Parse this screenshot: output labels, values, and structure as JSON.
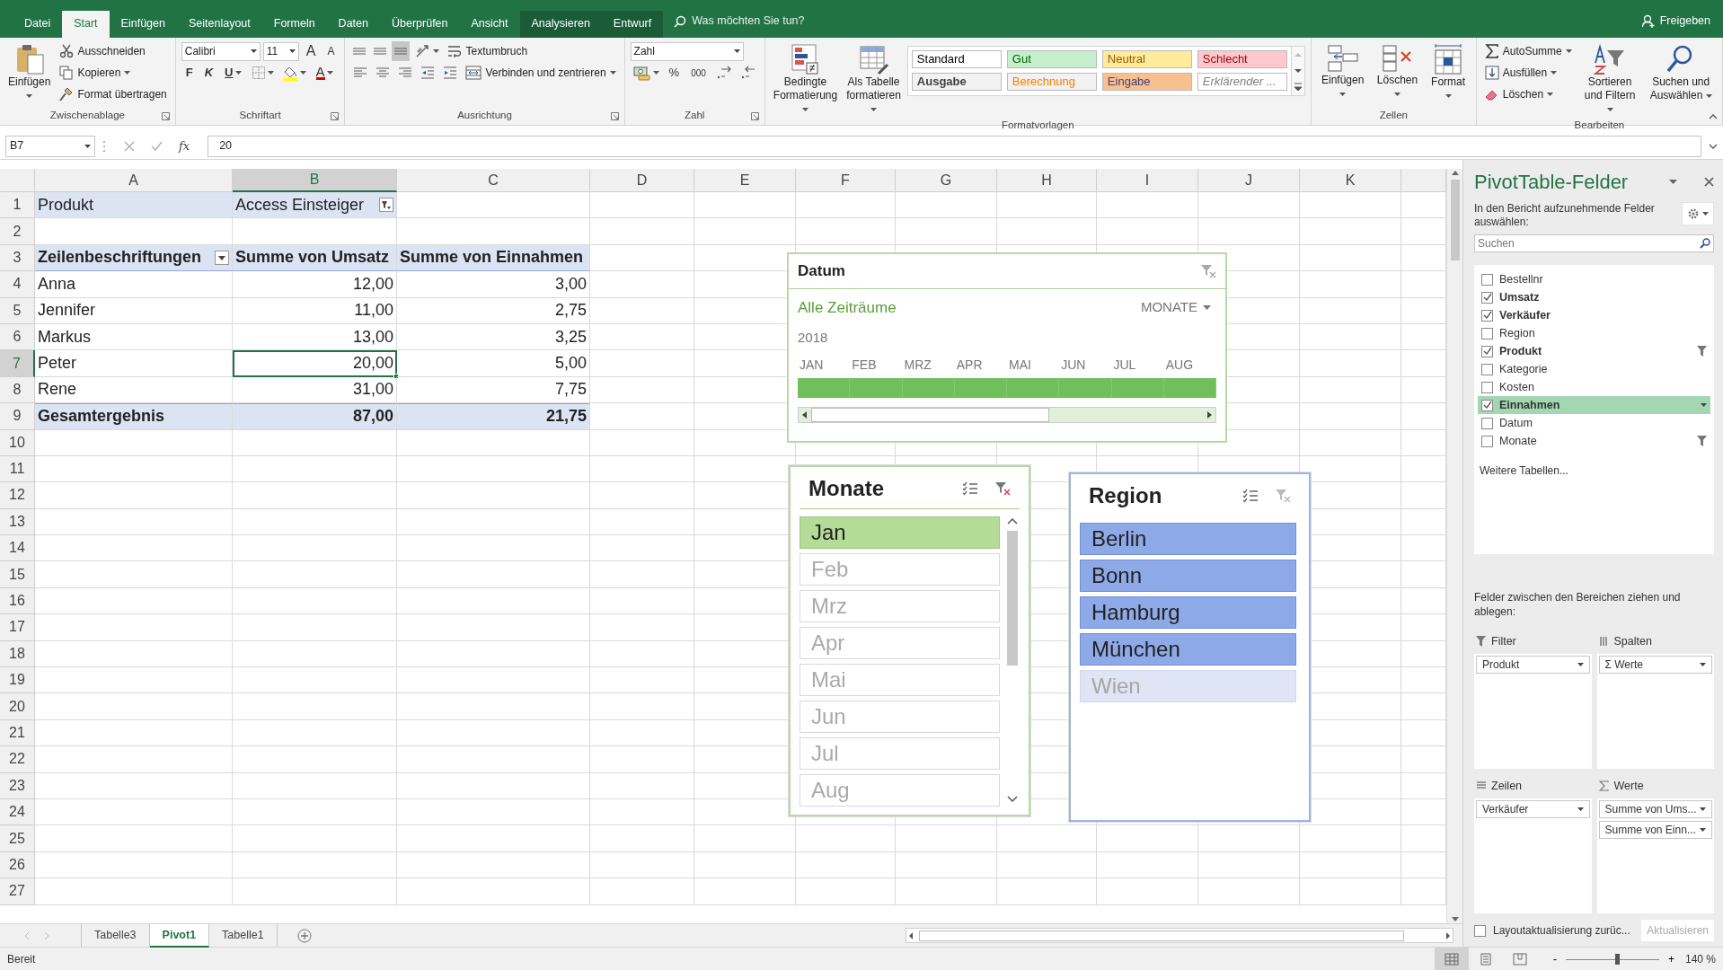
{
  "title_bar": {
    "tabs": [
      {
        "label": "Datei",
        "selected": false,
        "contextual": false
      },
      {
        "label": "Start",
        "selected": true,
        "contextual": false
      },
      {
        "label": "Einfügen",
        "selected": false,
        "contextual": false
      },
      {
        "label": "Seitenlayout",
        "selected": false,
        "contextual": false
      },
      {
        "label": "Formeln",
        "selected": false,
        "contextual": false
      },
      {
        "label": "Daten",
        "selected": false,
        "contextual": false
      },
      {
        "label": "Überprüfen",
        "selected": false,
        "contextual": false
      },
      {
        "label": "Ansicht",
        "selected": false,
        "contextual": false
      },
      {
        "label": "Analysieren",
        "selected": false,
        "contextual": true
      },
      {
        "label": "Entwurf",
        "selected": false,
        "contextual": true
      }
    ],
    "tell_me": "Was möchten Sie tun?",
    "share": "Freigeben"
  },
  "ribbon": {
    "groups": [
      {
        "label": "Zwischenablage",
        "launcher": true,
        "items": [
          {
            "kind": "large",
            "label": "Einfügen",
            "caret": true
          },
          {
            "kind": "stack",
            "rows": [
              {
                "items": [
                  {
                    "kind": "small",
                    "label": "Ausschneiden",
                    "caret": false
                  }
                ]
              },
              {
                "items": [
                  {
                    "kind": "small",
                    "label": "Kopieren",
                    "caret": true
                  }
                ]
              },
              {
                "items": [
                  {
                    "kind": "small",
                    "label": "Format übertragen",
                    "caret": false
                  }
                ]
              }
            ]
          }
        ]
      },
      {
        "label": "Schriftart",
        "launcher": true,
        "items": [
          {
            "kind": "stack",
            "rows": [
              {
                "items": [
                  {
                    "kind": "combo",
                    "value": "Calibri"
                  },
                  {
                    "kind": "combo",
                    "value": "11"
                  },
                  {
                    "kind": "glyph",
                    "label": "A",
                    "caret": false
                  },
                  {
                    "kind": "glyph",
                    "label": "A",
                    "caret": false
                  }
                ]
              },
              {
                "items": [
                  {
                    "kind": "glyph",
                    "label": "F",
                    "caret": false
                  },
                  {
                    "kind": "glyph",
                    "label": "K",
                    "caret": false
                  },
                  {
                    "kind": "glyph",
                    "label": "U",
                    "caret": true
                  },
                  {
                    "kind": "icon",
                    "pressed": false,
                    "caret": true
                  },
                  {
                    "kind": "icon",
                    "pressed": false,
                    "caret": true
                  },
                  {
                    "kind": "glyph",
                    "label": "A",
                    "caret": true
                  }
                ]
              }
            ]
          }
        ]
      },
      {
        "label": "Ausrichtung",
        "launcher": true,
        "items": [
          {
            "kind": "stack",
            "rows": [
              {
                "items": [
                  {
                    "kind": "icon",
                    "pressed": false,
                    "caret": false
                  },
                  {
                    "kind": "icon",
                    "pressed": false,
                    "caret": false
                  },
                  {
                    "kind": "icon",
                    "pressed": true,
                    "caret": false
                  },
                  {
                    "kind": "icon",
                    "pressed": false,
                    "caret": true
                  },
                  {
                    "kind": "small",
                    "label": "Textumbruch",
                    "caret": false
                  }
                ]
              },
              {
                "items": [
                  {
                    "kind": "icon",
                    "pressed": false,
                    "caret": false
                  },
                  {
                    "kind": "icon",
                    "pressed": false,
                    "caret": false
                  },
                  {
                    "kind": "icon",
                    "pressed": false,
                    "caret": false
                  },
                  {
                    "kind": "icon",
                    "pressed": false,
                    "caret": false
                  },
                  {
                    "kind": "icon",
                    "pressed": false,
                    "caret": false
                  },
                  {
                    "kind": "small",
                    "label": "Verbinden und zentrieren",
                    "caret": true
                  }
                ]
              }
            ]
          }
        ]
      },
      {
        "label": "Zahl",
        "launcher": true,
        "items": [
          {
            "kind": "stack",
            "rows": [
              {
                "items": [
                  {
                    "kind": "combo",
                    "value": "Zahl"
                  }
                ]
              },
              {
                "items": [
                  {
                    "kind": "icon",
                    "pressed": false,
                    "caret": true
                  },
                  {
                    "kind": "glyph",
                    "label": "%",
                    "caret": false
                  },
                  {
                    "kind": "glyph",
                    "label": "000",
                    "caret": false
                  },
                  {
                    "kind": "icon",
                    "pressed": false,
                    "caret": false
                  },
                  {
                    "kind": "icon",
                    "pressed": false,
                    "caret": false
                  }
                ]
              }
            ]
          }
        ]
      },
      {
        "label": "Formatvorlagen",
        "launcher": false,
        "items": [
          {
            "kind": "large",
            "label": "Bedingte Formatierung",
            "caret": true
          },
          {
            "kind": "large",
            "label": "Als Tabelle formatieren",
            "caret": true
          },
          {
            "kind": "gallery",
            "styles": [
              {
                "label": "Standard",
                "color": "#ffffff"
              },
              {
                "label": "Gut",
                "color": "#c6efce"
              },
              {
                "label": "Neutral",
                "color": "#ffeb9c"
              },
              {
                "label": "Schlecht",
                "color": "#ffc7ce"
              },
              {
                "label": "Ausgabe",
                "color": "#f2f2f2"
              },
              {
                "label": "Berechnung",
                "color": "#f2f2f2"
              },
              {
                "label": "Eingabe",
                "color": "#f8c08f"
              },
              {
                "label": "Erklärender ...",
                "color": "#ffffff"
              }
            ]
          }
        ]
      },
      {
        "label": "Zellen",
        "launcher": false,
        "items": [
          {
            "kind": "large",
            "label": "Einfügen",
            "caret": true
          },
          {
            "kind": "large",
            "label": "Löschen",
            "caret": true
          },
          {
            "kind": "large",
            "label": "Format",
            "caret": true
          }
        ]
      },
      {
        "label": "Bearbeiten",
        "launcher": false,
        "items": [
          {
            "kind": "stack",
            "rows": [
              {
                "items": [
                  {
                    "kind": "small",
                    "label": "AutoSumme",
                    "caret": true
                  }
                ]
              },
              {
                "items": [
                  {
                    "kind": "small",
                    "label": "Ausfüllen",
                    "caret": true
                  }
                ]
              },
              {
                "items": [
                  {
                    "kind": "small",
                    "label": "Löschen",
                    "caret": true
                  }
                ]
              }
            ]
          },
          {
            "kind": "large",
            "label": "Sortieren und Filtern",
            "caret": true
          },
          {
            "kind": "large",
            "label": "Suchen und Auswählen",
            "caret": true
          }
        ]
      }
    ]
  },
  "formula_bar": {
    "name_box": "B7",
    "function_label": "fx",
    "value": "20"
  },
  "sheet": {
    "columns": [
      {
        "label": "A",
        "selected": false
      },
      {
        "label": "B",
        "selected": true
      },
      {
        "label": "C",
        "selected": false
      },
      {
        "label": "D",
        "selected": false
      },
      {
        "label": "E",
        "selected": false
      },
      {
        "label": "F",
        "selected": false
      },
      {
        "label": "G",
        "selected": false
      },
      {
        "label": "H",
        "selected": false
      },
      {
        "label": "I",
        "selected": false
      },
      {
        "label": "J",
        "selected": false
      },
      {
        "label": "K",
        "selected": false
      }
    ],
    "rows": [
      {
        "number": "1",
        "selected": false,
        "kind": "page_filter",
        "cells": [
          {
            "text": "Produkt",
            "active": false,
            "dropdown": false
          },
          {
            "text": "Access Einsteiger",
            "active": false,
            "dropdown": true,
            "filtered": true
          }
        ]
      },
      {
        "number": "2",
        "selected": false,
        "kind": "blank"
      },
      {
        "number": "3",
        "selected": false,
        "kind": "header",
        "cells": [
          {
            "text": "Zeilenbeschriftungen",
            "active": false,
            "dropdown": true,
            "filtered": false
          },
          {
            "text": "Summe von Umsatz",
            "active": false,
            "dropdown": false
          },
          {
            "text": "Summe von Einnahmen",
            "active": false,
            "dropdown": false
          }
        ]
      },
      {
        "number": "4",
        "selected": false,
        "kind": "item",
        "cells": [
          {
            "text": "Anna",
            "active": false,
            "dropdown": false
          },
          {
            "text": "12,00",
            "active": false,
            "dropdown": false
          },
          {
            "text": "3,00",
            "active": false,
            "dropdown": false
          }
        ]
      },
      {
        "number": "5",
        "selected": false,
        "kind": "item",
        "cells": [
          {
            "text": "Jennifer",
            "active": false,
            "dropdown": false
          },
          {
            "text": "11,00",
            "active": false,
            "dropdown": false
          },
          {
            "text": "2,75",
            "active": false,
            "dropdown": false
          }
        ]
      },
      {
        "number": "6",
        "selected": false,
        "kind": "item",
        "cells": [
          {
            "text": "Markus",
            "active": false,
            "dropdown": false
          },
          {
            "text": "13,00",
            "active": false,
            "dropdown": false
          },
          {
            "text": "3,25",
            "active": false,
            "dropdown": false
          }
        ]
      },
      {
        "number": "7",
        "selected": true,
        "kind": "item",
        "cells": [
          {
            "text": "Peter",
            "active": false,
            "dropdown": false
          },
          {
            "text": "20,00",
            "active": true,
            "dropdown": false
          },
          {
            "text": "5,00",
            "active": false,
            "dropdown": false
          }
        ]
      },
      {
        "number": "8",
        "selected": false,
        "kind": "item",
        "cells": [
          {
            "text": "Rene",
            "active": false,
            "dropdown": false
          },
          {
            "text": "31,00",
            "active": false,
            "dropdown": false
          },
          {
            "text": "7,75",
            "active": false,
            "dropdown": false
          }
        ]
      },
      {
        "number": "9",
        "selected": false,
        "kind": "total",
        "cells": [
          {
            "text": "Gesamtergebnis",
            "active": false,
            "dropdown": false
          },
          {
            "text": "87,00",
            "active": false,
            "dropdown": false
          },
          {
            "text": "21,75",
            "active": false,
            "dropdown": false
          }
        ]
      },
      {
        "number": "10",
        "selected": false,
        "kind": "blank"
      },
      {
        "number": "11",
        "selected": false,
        "kind": "blank"
      },
      {
        "number": "12",
        "selected": false,
        "kind": "blank"
      },
      {
        "number": "13",
        "selected": false,
        "kind": "blank"
      },
      {
        "number": "14",
        "selected": false,
        "kind": "blank"
      },
      {
        "number": "15",
        "selected": false,
        "kind": "blank"
      },
      {
        "number": "16",
        "selected": false,
        "kind": "blank"
      },
      {
        "number": "17",
        "selected": false,
        "kind": "blank"
      },
      {
        "number": "18",
        "selected": false,
        "kind": "blank"
      },
      {
        "number": "19",
        "selected": false,
        "kind": "blank"
      },
      {
        "number": "20",
        "selected": false,
        "kind": "blank"
      },
      {
        "number": "21",
        "selected": false,
        "kind": "blank"
      },
      {
        "number": "22",
        "selected": false,
        "kind": "blank"
      },
      {
        "number": "23",
        "selected": false,
        "kind": "blank"
      },
      {
        "number": "24",
        "selected": false,
        "kind": "blank"
      },
      {
        "number": "25",
        "selected": false,
        "kind": "blank"
      },
      {
        "number": "26",
        "selected": false,
        "kind": "blank"
      },
      {
        "number": "27",
        "selected": false,
        "kind": "blank"
      }
    ]
  },
  "timeline": {
    "title": "Datum",
    "filtered": false,
    "range_label": "Alle Zeiträume",
    "level_label": "MONATE",
    "year": "2018",
    "months": [
      {
        "label": "JAN",
        "selected": true
      },
      {
        "label": "FEB",
        "selected": true
      },
      {
        "label": "MRZ",
        "selected": true
      },
      {
        "label": "APR",
        "selected": true
      },
      {
        "label": "MAI",
        "selected": true
      },
      {
        "label": "JUN",
        "selected": true
      },
      {
        "label": "JUL",
        "selected": true
      },
      {
        "label": "AUG",
        "selected": true
      }
    ]
  },
  "slicers": [
    {
      "title": "Monate",
      "filtered": true,
      "scrollable": true,
      "items": [
        {
          "label": "Jan",
          "selected": true
        },
        {
          "label": "Feb",
          "selected": false
        },
        {
          "label": "Mrz",
          "selected": false
        },
        {
          "label": "Apr",
          "selected": false
        },
        {
          "label": "Mai",
          "selected": false
        },
        {
          "label": "Jun",
          "selected": false
        },
        {
          "label": "Jul",
          "selected": false
        },
        {
          "label": "Aug",
          "selected": false
        }
      ]
    },
    {
      "title": "Region",
      "filtered": false,
      "scrollable": false,
      "items": [
        {
          "label": "Berlin",
          "selected": true
        },
        {
          "label": "Bonn",
          "selected": true
        },
        {
          "label": "Hamburg",
          "selected": true
        },
        {
          "label": "München",
          "selected": true
        },
        {
          "label": "Wien",
          "selected": false
        }
      ]
    }
  ],
  "sheet_tabs": [
    {
      "label": "Tabelle3",
      "selected": false
    },
    {
      "label": "Pivot1",
      "selected": true
    },
    {
      "label": "Tabelle1",
      "selected": false
    }
  ],
  "pivot_pane": {
    "title": "PivotTable-Felder",
    "subtitle": "In den Bericht aufzunehmende Felder auswählen:",
    "search": {
      "placeholder": "Suchen"
    },
    "fields": [
      {
        "label": "Bestellnr",
        "checked": false,
        "selected": false,
        "filter": false
      },
      {
        "label": "Umsatz",
        "checked": true,
        "selected": false,
        "filter": false
      },
      {
        "label": "Verkäufer",
        "checked": true,
        "selected": false,
        "filter": false
      },
      {
        "label": "Region",
        "checked": false,
        "selected": false,
        "filter": false
      },
      {
        "label": "Produkt",
        "checked": true,
        "selected": false,
        "filter": true
      },
      {
        "label": "Kategorie",
        "checked": false,
        "selected": false,
        "filter": false
      },
      {
        "label": "Kosten",
        "checked": false,
        "selected": false,
        "filter": false
      },
      {
        "label": "Einnahmen",
        "checked": true,
        "selected": true,
        "filter": false
      },
      {
        "label": "Datum",
        "checked": false,
        "selected": false,
        "filter": false
      },
      {
        "label": "Monate",
        "checked": false,
        "selected": false,
        "filter": true
      }
    ],
    "more_tables": "Weitere Tabellen...",
    "areas_hint": "Felder zwischen den Bereichen ziehen und ablegen:",
    "areas": [
      {
        "title": "Filter",
        "items": [
          "Produkt"
        ]
      },
      {
        "title": "Spalten",
        "items": [
          "Σ Werte"
        ]
      },
      {
        "title": "Zeilen",
        "items": [
          "Verkäufer"
        ]
      },
      {
        "title": "Werte",
        "items": [
          "Summe von Ums...",
          "Summe von Einn..."
        ]
      }
    ],
    "defer": {
      "label": "Layoutaktualisierung zurüc...",
      "checked": false
    },
    "update_button": {
      "label": "Aktualisieren",
      "disabled": true
    }
  },
  "status_bar": {
    "text": "Bereit",
    "views": [
      {
        "selected": true
      },
      {
        "selected": false
      },
      {
        "selected": false
      }
    ],
    "zoom": {
      "minus": "-",
      "plus": "+",
      "level": 0.55,
      "reading": "140 %"
    }
  }
}
